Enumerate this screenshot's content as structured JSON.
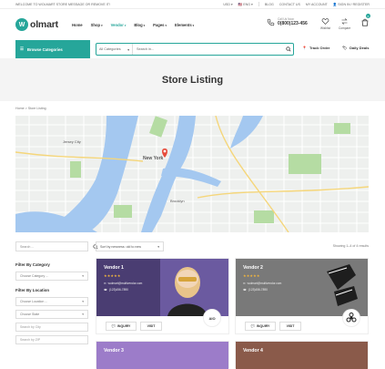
{
  "topbar": {
    "welcome": "WELCOME TO WOLMART STORE MESSAGE OR REMOVE IT!",
    "currency": "USD",
    "language": "ENG",
    "links": [
      "BLOG",
      "CONTACT US",
      "MY ACCOUNT",
      "SIGN IN / REGISTER"
    ]
  },
  "header": {
    "logo_mark": "W",
    "logo_text": "olmart",
    "nav": [
      {
        "label": "Home",
        "chevron": false
      },
      {
        "label": "Shop",
        "chevron": true
      },
      {
        "label": "Vendor",
        "chevron": true,
        "active": true
      },
      {
        "label": "Blog",
        "chevron": true
      },
      {
        "label": "Pages",
        "chevron": true
      },
      {
        "label": "Elements",
        "chevron": true
      }
    ],
    "call_label": "Call Us Now:",
    "phone": "0(800)123-456",
    "wishlist": "Wishlist",
    "compare": "Compare",
    "cart_count": "0",
    "accent": "#26a69a"
  },
  "subbar": {
    "browse": "Browse Categories",
    "all_categories": "All Categories",
    "search_placeholder": "Search in...",
    "track_order": "Track Order",
    "daily_deals": "Daily Deals"
  },
  "page": {
    "title": "Store Listing",
    "breadcrumb": [
      "Home",
      "Store Listing"
    ]
  },
  "toolbar": {
    "search_placeholder": "Search ...",
    "sort_value": "Sort by newness: old to new",
    "showing": "Showing 1–4 of 4 results"
  },
  "filters": {
    "category_heading": "Filter By Category",
    "category_select": "Choose Category ...",
    "location_heading": "Filter By Location",
    "location_select": "Choose Location ...",
    "state_select": "Choose State",
    "city_placeholder": "Search by City",
    "zip_placeholder": "Search by ZIP"
  },
  "vendors": [
    {
      "name": "Vendor 1",
      "email": "wolmart@multivendor.com",
      "phone": "(123)456-7890",
      "inquiry": "INQUIRY",
      "visit": "VISIT",
      "badge": "AIO"
    },
    {
      "name": "Vendor 2",
      "email": "wolmart@multivendor.com",
      "phone": "(123)456-7890",
      "inquiry": "INQUIRY",
      "visit": "VISIT",
      "badge": ""
    },
    {
      "name": "Vendor 3"
    },
    {
      "name": "Vendor 4"
    }
  ]
}
